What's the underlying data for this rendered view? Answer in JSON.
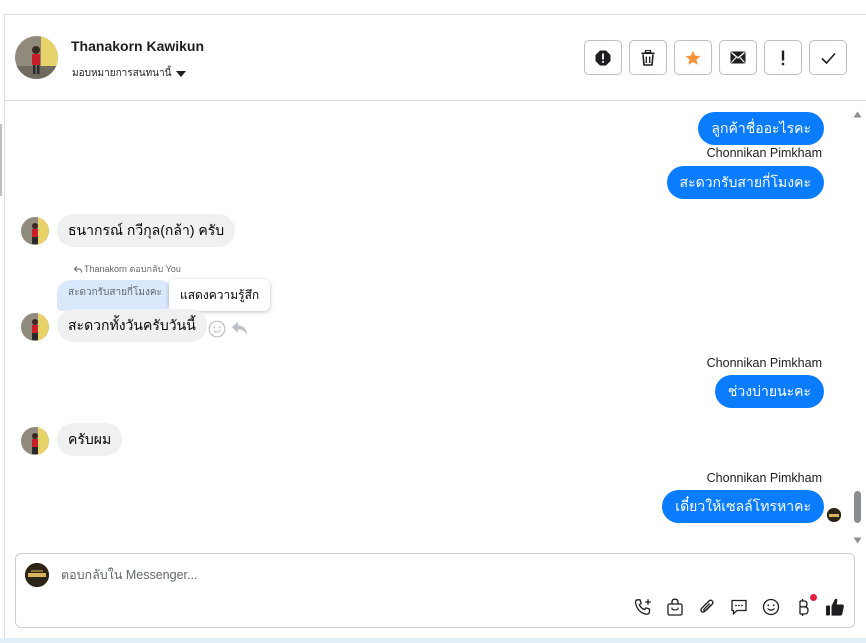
{
  "header": {
    "contact_name": "Thanakorn Kawikun",
    "assign_label": "มอบหมายการสนทนานี้"
  },
  "actions": [
    {
      "name": "report-spam-icon"
    },
    {
      "name": "trash-icon"
    },
    {
      "name": "star-icon"
    },
    {
      "name": "mail-icon"
    },
    {
      "name": "exclamation-icon"
    },
    {
      "name": "checkmark-icon"
    }
  ],
  "messages": {
    "m1_text": "ลูกค้าชื่ออะไรคะ",
    "m2_sender": "Chonnikan Pimkham",
    "m2_text": "สะดวกรับสายกี่โมงคะ",
    "m3_text": "ธนากรณ์ กวีกุล(กล้า) ครับ",
    "m4_reply_meta": "Thanakorn ตอบกลับ You",
    "m4_quoted": "สะดวกรับสายกี่โมงคะ",
    "m4_text": "สะดวกทั้งวันครับวันนี้",
    "m4_tooltip": "แสดงความรู้สึก",
    "m5_sender": "Chonnikan Pimkham",
    "m5_text": "ช่วงบ่ายนะคะ",
    "m6_text": "ครับผม",
    "m7_sender": "Chonnikan Pimkham",
    "m7_text": "เดี๋ยวให้เซลล์โทรหาคะ"
  },
  "composer": {
    "placeholder": "ตอบกลับใน Messenger..."
  },
  "colors": {
    "outgoing_bubble": "#0a7cff",
    "incoming_bubble": "#eff0f2",
    "quoted_bubble": "#d9e8fb",
    "star": "#f7923b"
  }
}
